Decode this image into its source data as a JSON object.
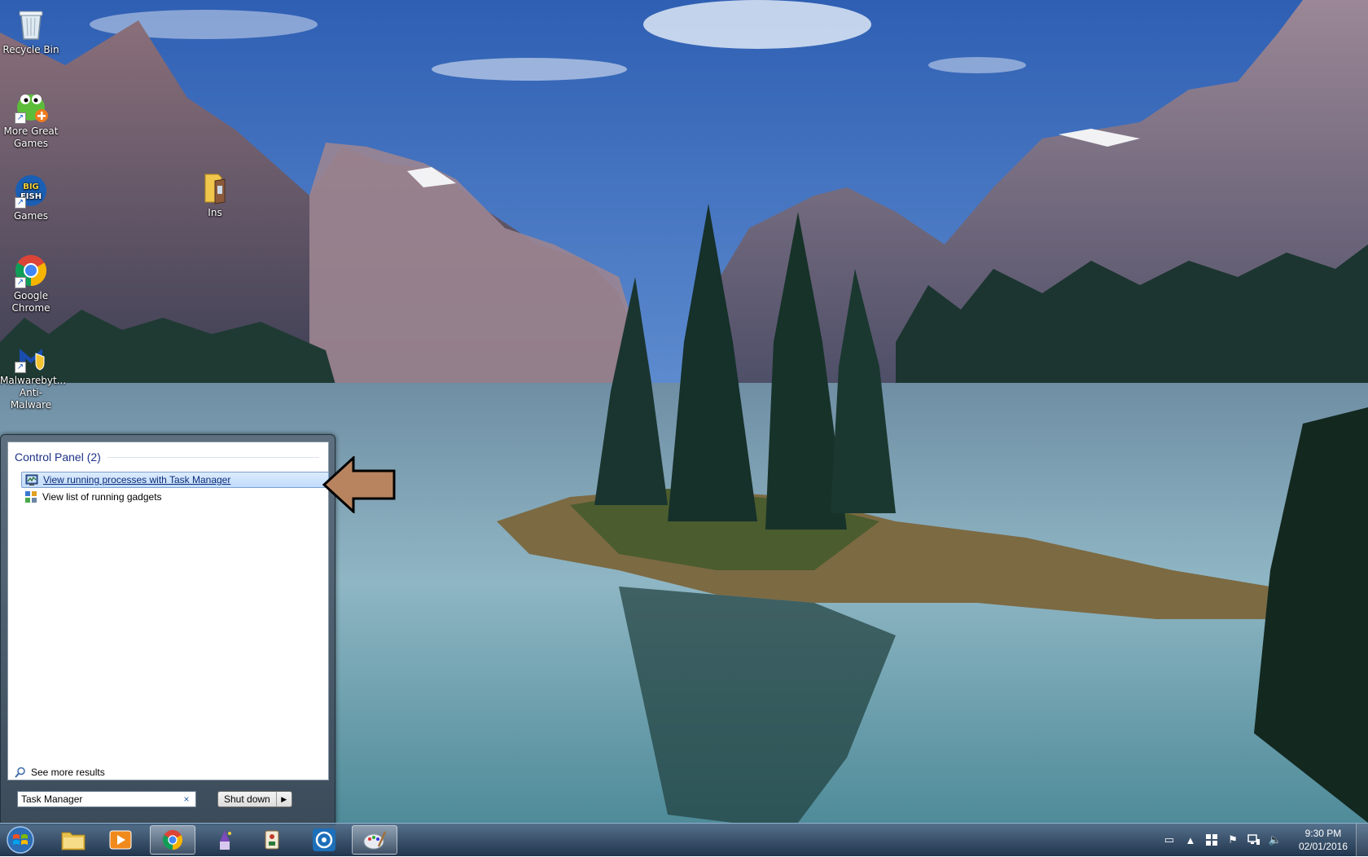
{
  "desktop": {
    "icons": [
      {
        "label": "Recycle Bin"
      },
      {
        "label": "More Great Games"
      },
      {
        "label": "Games"
      },
      {
        "label": "Ins"
      },
      {
        "label": "Google Chrome"
      },
      {
        "label": "Malwarebyt... Anti-Malware"
      }
    ]
  },
  "start_menu": {
    "section_header": "Control Panel (2)",
    "results": [
      {
        "label": "View running processes with Task Manager"
      },
      {
        "label": "View list of running gadgets"
      }
    ],
    "see_more": "See more results",
    "search_value": "Task Manager",
    "clear_glyph": "×",
    "shutdown_label": "Shut down",
    "shutdown_arrow": "▶"
  },
  "taskbar": {
    "pinned": [
      {
        "icon": "windows-explorer-icon"
      },
      {
        "icon": "media-player-icon"
      },
      {
        "icon": "google-chrome-icon"
      },
      {
        "icon": "wizard-game-icon"
      },
      {
        "icon": "mahjong-game-icon"
      },
      {
        "icon": "app-circle-icon"
      },
      {
        "icon": "paint-icon"
      }
    ],
    "clock": {
      "time": "9:30 PM",
      "date": "02/01/2016"
    }
  },
  "colors": {
    "accent": "#1e3287",
    "highlight_border": "#7da2ce",
    "arrow_fill": "#b8845f"
  }
}
